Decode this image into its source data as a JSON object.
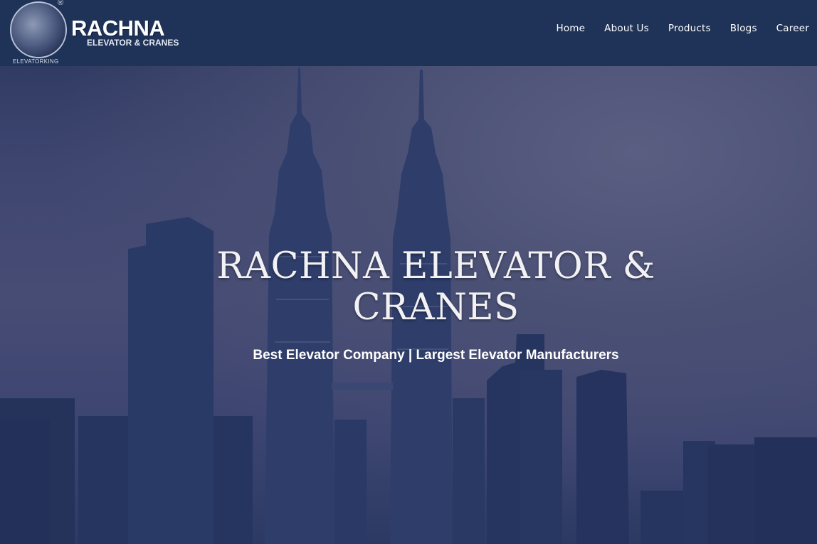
{
  "header": {
    "logo": {
      "name": "RACHNA",
      "tagline": "ELEVATOR & CRANES",
      "sub": "ELEVATORKING",
      "registered": "®"
    },
    "nav": [
      {
        "label": "Home"
      },
      {
        "label": "About Us"
      },
      {
        "label": "Products"
      },
      {
        "label": "Blogs"
      },
      {
        "label": "Career"
      }
    ]
  },
  "hero": {
    "title_line1": "RACHNA ELEVATOR &",
    "title_line2": "CRANES",
    "subtitle": "Best Elevator Company | Largest Elevator Manufacturers",
    "background_image": "city-skyline-twin-towers"
  },
  "colors": {
    "header_bg": "#1f3358",
    "hero_overlay": "#2a3558",
    "text": "#ffffff"
  }
}
